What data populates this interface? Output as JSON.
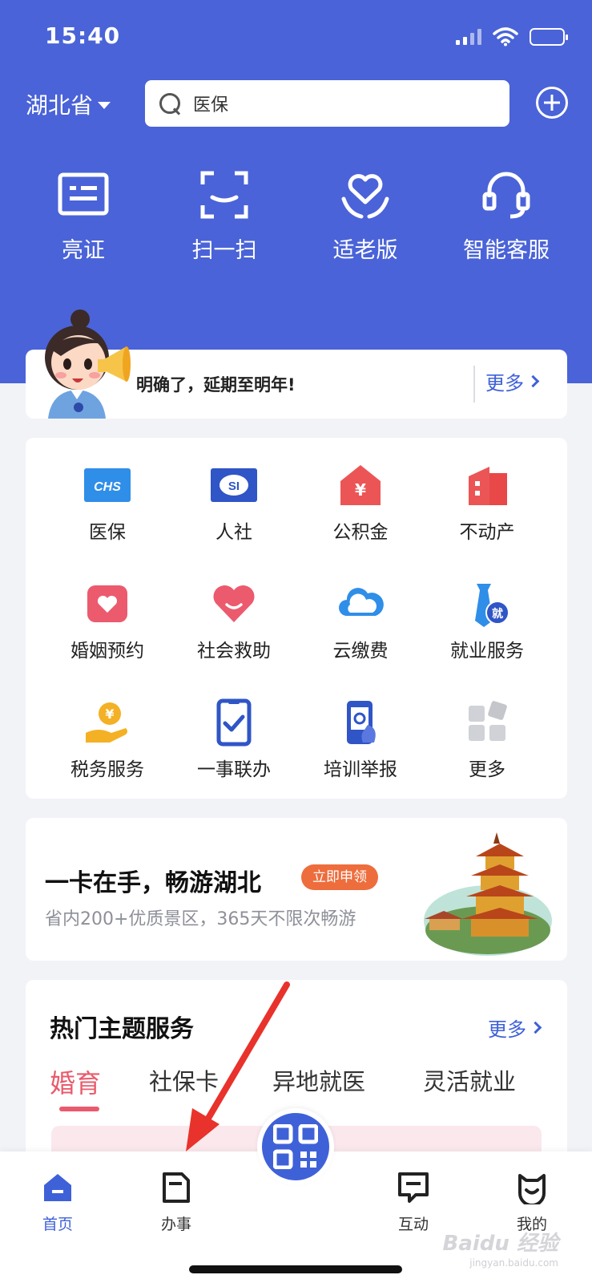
{
  "status": {
    "time": "15:40"
  },
  "header": {
    "region": "湖北省",
    "search_placeholder": "医保"
  },
  "quick_actions": [
    {
      "label": "亮证",
      "icon": "id-card-icon"
    },
    {
      "label": "扫一扫",
      "icon": "scan-frame-icon"
    },
    {
      "label": "适老版",
      "icon": "elder-care-icon"
    },
    {
      "label": "智能客服",
      "icon": "headset-icon"
    }
  ],
  "notice": {
    "text": "明确了，延期至明年!",
    "more": "更多"
  },
  "services": [
    {
      "label": "医保",
      "icon": "chs-icon"
    },
    {
      "label": "人社",
      "icon": "si-icon"
    },
    {
      "label": "公积金",
      "icon": "housing-fund-icon"
    },
    {
      "label": "不动产",
      "icon": "real-estate-icon"
    },
    {
      "label": "婚姻预约",
      "icon": "marriage-icon"
    },
    {
      "label": "社会救助",
      "icon": "heart-icon"
    },
    {
      "label": "云缴费",
      "icon": "cloud-icon"
    },
    {
      "label": "就业服务",
      "icon": "employment-icon"
    },
    {
      "label": "税务服务",
      "icon": "tax-icon"
    },
    {
      "label": "一事联办",
      "icon": "checklist-icon"
    },
    {
      "label": "培训举报",
      "icon": "phone-report-icon"
    },
    {
      "label": "更多",
      "icon": "more-grid-icon"
    }
  ],
  "banner": {
    "title": "一卡在手，畅游湖北",
    "badge": "立即申领",
    "subtitle": "省内200+优质景区，365天不限次畅游"
  },
  "hot_topics": {
    "title": "热门主题服务",
    "more": "更多",
    "tabs": [
      "婚育",
      "社保卡",
      "异地就医",
      "灵活就业"
    ],
    "active_tab": 0
  },
  "tabbar": [
    {
      "label": "首页",
      "icon": "home-icon",
      "active": true
    },
    {
      "label": "办事",
      "icon": "document-icon",
      "active": false
    },
    {
      "label": "互动",
      "icon": "chat-icon",
      "active": false
    },
    {
      "label": "我的",
      "icon": "smile-icon",
      "active": false
    }
  ],
  "watermark": {
    "text": "Baidu 经验",
    "sub": "jingyan.baidu.com"
  },
  "colors": {
    "brand": "#4a63d8",
    "link": "#3f61d8",
    "accent_red": "#e95b6c",
    "badge_orange": "#ee6d3d",
    "annotation_arrow": "#e8322b"
  }
}
